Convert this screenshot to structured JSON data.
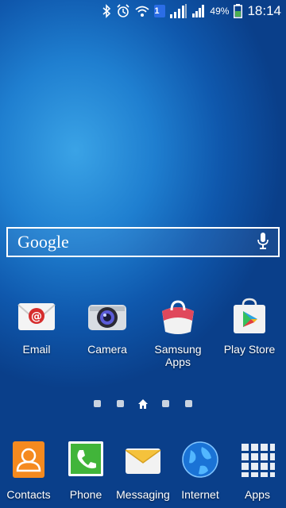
{
  "status_bar": {
    "battery_percent": "49%",
    "time": "18:14",
    "sim_badge": "1",
    "icons": [
      "bluetooth-icon",
      "alarm-icon",
      "wifi-icon",
      "sim-badge",
      "signal-icon",
      "signal-icon",
      "battery-icon"
    ]
  },
  "search": {
    "label": "Google",
    "mic_icon": "mic-icon"
  },
  "home_apps": [
    {
      "label": "Email",
      "icon": "email-icon"
    },
    {
      "label": "Camera",
      "icon": "camera-icon"
    },
    {
      "label": "Samsung Apps",
      "icon": "samsung-apps-icon"
    },
    {
      "label": "Play Store",
      "icon": "play-store-icon"
    }
  ],
  "page_indicator": {
    "total": 5,
    "current": 3,
    "current_icon": "home-icon"
  },
  "dock": [
    {
      "label": "Contacts",
      "icon": "contacts-icon"
    },
    {
      "label": "Phone",
      "icon": "phone-icon"
    },
    {
      "label": "Messaging",
      "icon": "messaging-icon"
    },
    {
      "label": "Internet",
      "icon": "internet-icon"
    },
    {
      "label": "Apps",
      "icon": "apps-grid-icon"
    }
  ],
  "colors": {
    "wallpaper_light": "#3aa3e6",
    "wallpaper_dark": "#0a3f8a",
    "sim_badge": "#2b6de6",
    "battery_fill": "#4caf50"
  }
}
